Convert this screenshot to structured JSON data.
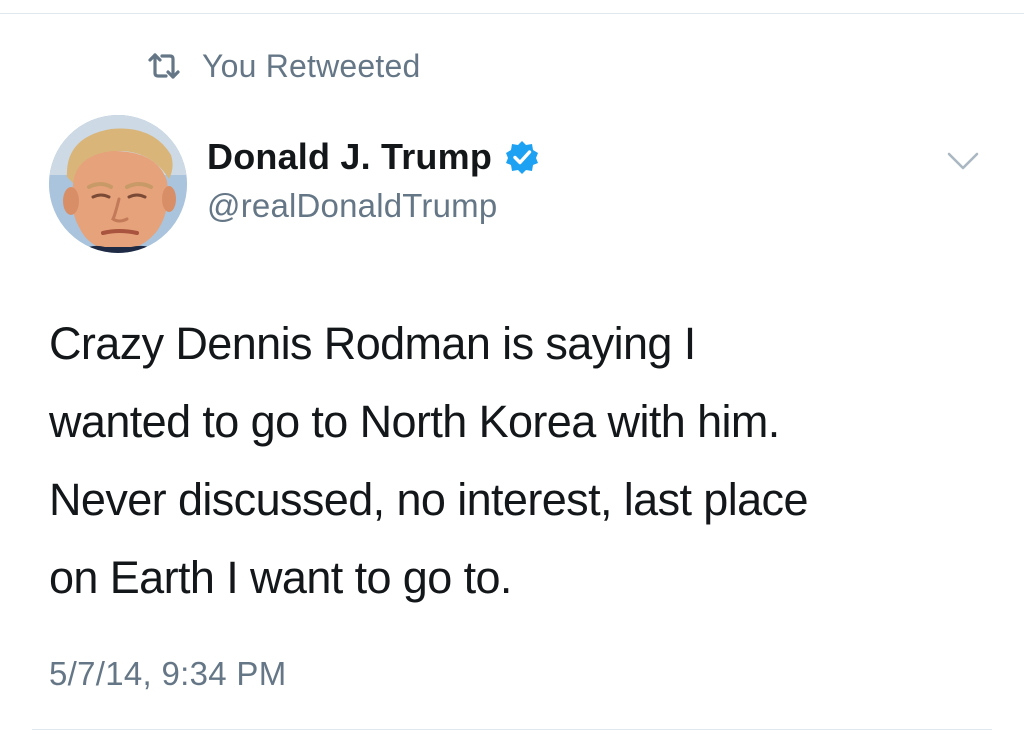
{
  "social_context": {
    "label": "You Retweeted",
    "icon": "retweet-icon"
  },
  "author": {
    "display_name": "Donald J. Trump",
    "handle": "@realDonaldTrump",
    "verified": true,
    "verified_icon": "verified-badge-icon",
    "avatar_icon": "avatar"
  },
  "menu": {
    "icon": "chevron-down-icon"
  },
  "tweet": {
    "lines": [
      "Crazy Dennis Rodman is saying I",
      "wanted to go to North Korea with him.",
      "Never discussed, no interest, last place",
      "on Earth I want to go to."
    ],
    "timestamp": "5/7/14, 9:34 PM"
  },
  "colors": {
    "text_primary": "#14171a",
    "text_secondary": "#657786",
    "verified_blue": "#1da1f2",
    "divider": "#e1e8ed"
  }
}
